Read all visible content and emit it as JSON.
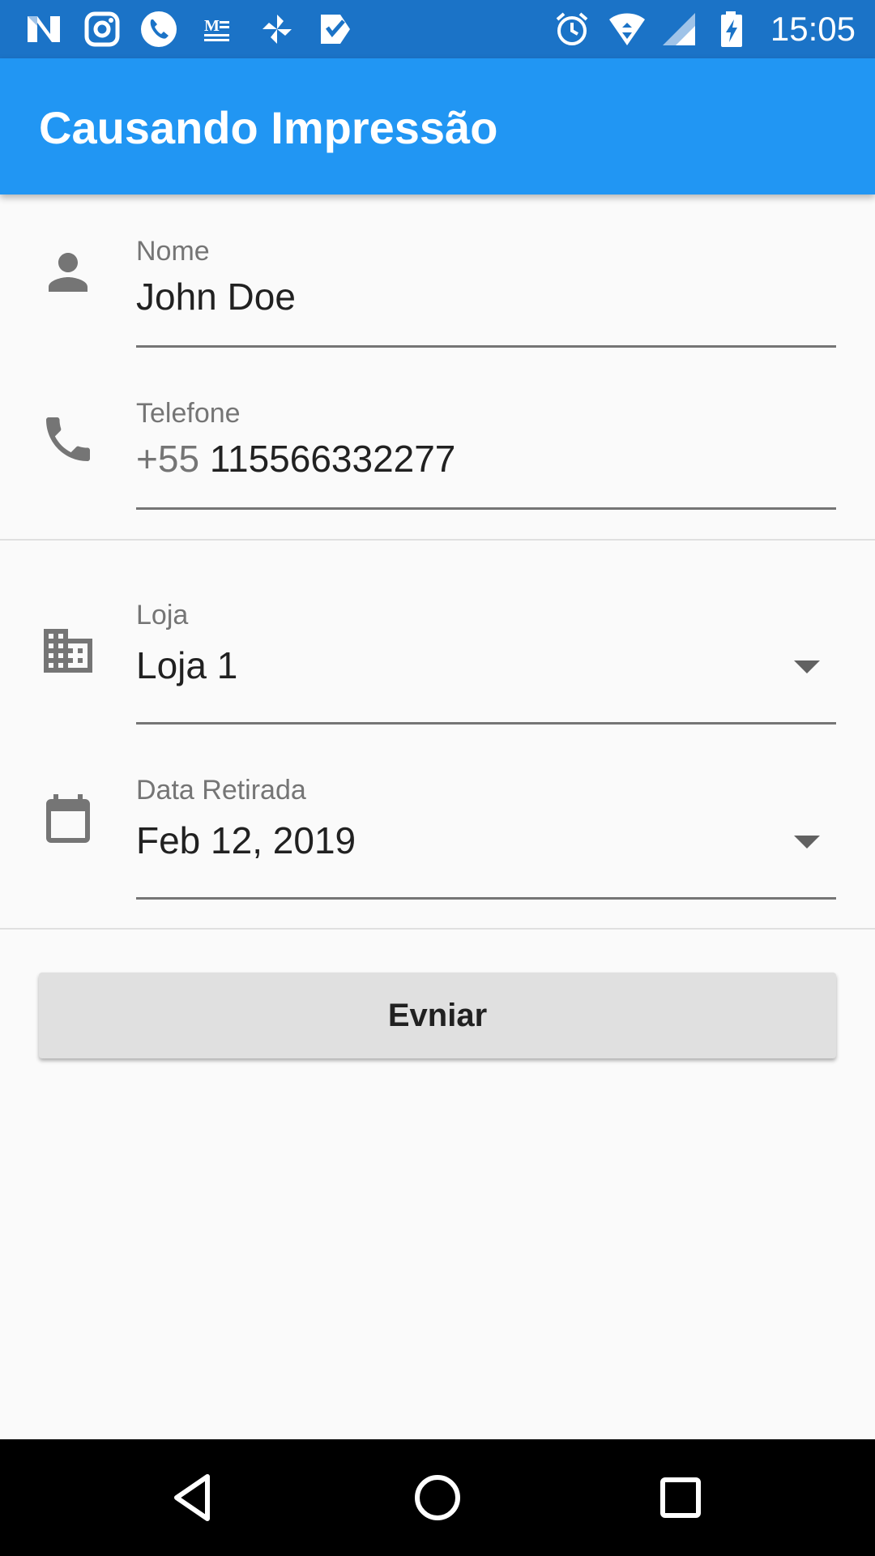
{
  "status_bar": {
    "time": "15:05",
    "left_icons": [
      "n-app-icon",
      "instagram-icon",
      "phone-call-icon",
      "news-icon",
      "pinwheel-icon",
      "checkmark-app-icon"
    ],
    "right_icons": [
      "alarm-icon",
      "wifi-icon",
      "signal-icon",
      "battery-charging-icon"
    ]
  },
  "app_bar": {
    "title": "Causando Impressão",
    "color": "#2196f3"
  },
  "form": {
    "nome": {
      "label": "Nome",
      "value": "John Doe",
      "icon": "person-icon"
    },
    "telefone": {
      "label": "Telefone",
      "prefix": "+55",
      "value": "115566332277",
      "icon": "phone-icon"
    },
    "loja": {
      "label": "Loja",
      "value": "Loja 1",
      "icon": "business-icon"
    },
    "data_retirada": {
      "label": "Data Retirada",
      "value": "Feb 12, 2019",
      "icon": "calendar-icon"
    }
  },
  "submit_button": {
    "label": "Evniar"
  },
  "nav_bar": {
    "buttons": [
      "back-icon",
      "home-icon",
      "recents-icon"
    ]
  }
}
